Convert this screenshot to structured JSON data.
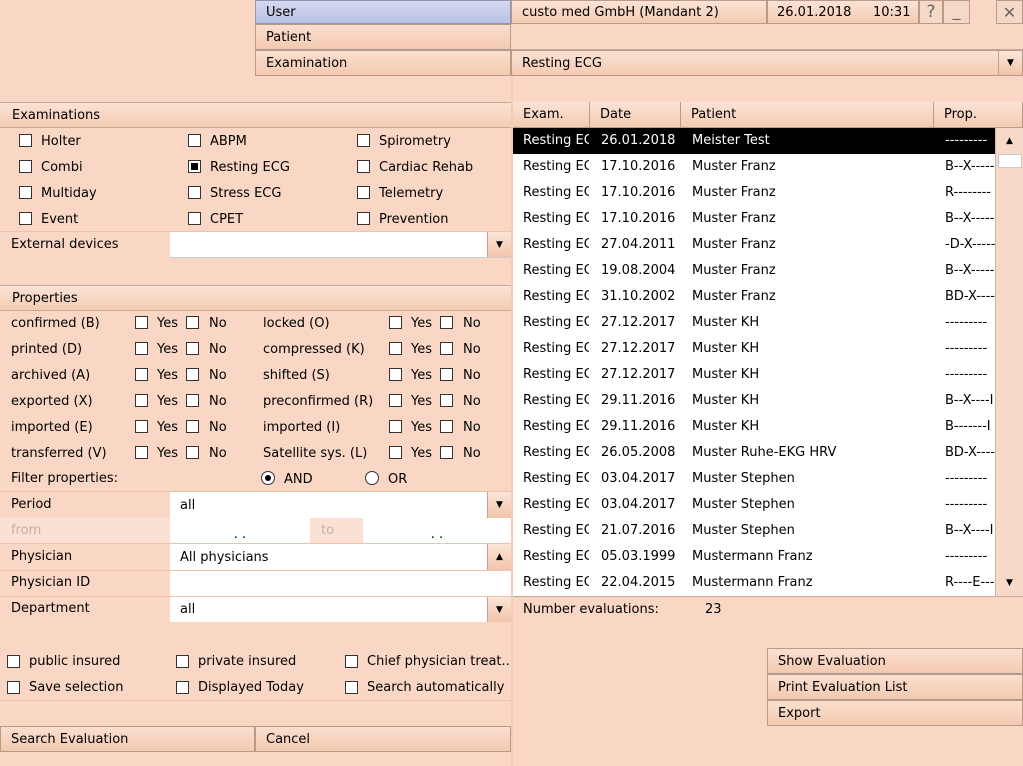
{
  "header": {
    "user_label": "User",
    "user_value": "custo med GmbH (Mandant 2)",
    "date": "26.01.2018",
    "time": "10:31",
    "help_glyph": "?",
    "minimize_glyph": "_",
    "close_glyph": "✕",
    "patient_label": "Patient",
    "patient_value": "",
    "examination_label": "Examination",
    "examination_value": "Resting ECG"
  },
  "examinations": {
    "title": "Examinations",
    "items": [
      {
        "label": "Holter",
        "checked": false
      },
      {
        "label": "ABPM",
        "checked": false
      },
      {
        "label": "Spirometry",
        "checked": false
      },
      {
        "label": "Combi",
        "checked": false
      },
      {
        "label": "Resting ECG",
        "checked": true
      },
      {
        "label": "Cardiac Rehab",
        "checked": false
      },
      {
        "label": "Multiday",
        "checked": false
      },
      {
        "label": "Stress ECG",
        "checked": false
      },
      {
        "label": "Telemetry",
        "checked": false
      },
      {
        "label": "Event",
        "checked": false
      },
      {
        "label": "CPET",
        "checked": false
      },
      {
        "label": "Prevention",
        "checked": false
      }
    ],
    "external_devices_label": "External devices",
    "external_devices_value": ""
  },
  "properties": {
    "title": "Properties",
    "yes": "Yes",
    "no": "No",
    "left": [
      "confirmed (B)",
      "printed (D)",
      "archived (A)",
      "exported (X)",
      "imported (E)",
      "transferred (V)"
    ],
    "right": [
      "locked (O)",
      "compressed (K)",
      "shifted (S)",
      "preconfirmed (R)",
      "imported (I)",
      "Satellite sys. (L)"
    ],
    "filter_label": "Filter properties:",
    "and_label": "AND",
    "or_label": "OR",
    "filter_selected": "AND"
  },
  "period": {
    "label": "Period",
    "value": "all",
    "from_label": "from",
    "to_label": "to",
    "from_value": ". .",
    "to_value": ". ."
  },
  "physician": {
    "label": "Physician",
    "value": "All physicians"
  },
  "physician_id": {
    "label": "Physician ID",
    "value": ""
  },
  "department": {
    "label": "Department",
    "value": "all"
  },
  "options": [
    {
      "label": "public insured",
      "checked": false
    },
    {
      "label": "private insured",
      "checked": false
    },
    {
      "label": "Chief physician treat...",
      "checked": false
    },
    {
      "label": "Save selection",
      "checked": false
    },
    {
      "label": "Displayed Today",
      "checked": false
    },
    {
      "label": "Search automatically",
      "checked": false
    }
  ],
  "buttons": {
    "search": "Search Evaluation",
    "cancel": "Cancel",
    "show": "Show Evaluation",
    "print": "Print Evaluation List",
    "export": "Export"
  },
  "table": {
    "columns": [
      "Exam.",
      "Date",
      "Patient",
      "Prop."
    ],
    "rows": [
      [
        "Resting ECG",
        "26.01.2018",
        "Meister Test",
        "---------"
      ],
      [
        "Resting ECG",
        "17.10.2016",
        "Muster Franz",
        "B--X-----"
      ],
      [
        "Resting ECG",
        "17.10.2016",
        "Muster Franz",
        "R--------"
      ],
      [
        "Resting ECG",
        "17.10.2016",
        "Muster Franz",
        "B--X-----"
      ],
      [
        "Resting ECG",
        "27.04.2011",
        "Muster Franz",
        "-D-X-----"
      ],
      [
        "Resting ECG",
        "19.08.2004",
        "Muster Franz",
        "B--X-----"
      ],
      [
        "Resting ECG",
        "31.10.2002",
        "Muster Franz",
        "BD-X-----"
      ],
      [
        "Resting ECG",
        "27.12.2017",
        "Muster KH",
        "---------"
      ],
      [
        "Resting ECG",
        "27.12.2017",
        "Muster KH",
        "---------"
      ],
      [
        "Resting ECG",
        "27.12.2017",
        "Muster KH",
        "---------"
      ],
      [
        "Resting ECG",
        "29.11.2016",
        "Muster KH",
        "B--X----I"
      ],
      [
        "Resting ECG",
        "29.11.2016",
        "Muster KH",
        "B-------I"
      ],
      [
        "Resting ECG",
        "26.05.2008",
        "Muster Ruhe-EKG HRV",
        "BD-X-----"
      ],
      [
        "Resting ECG",
        "03.04.2017",
        "Muster Stephen",
        "---------"
      ],
      [
        "Resting ECG",
        "03.04.2017",
        "Muster Stephen",
        "---------"
      ],
      [
        "Resting ECG",
        "21.07.2016",
        "Muster Stephen",
        "B--X----I"
      ],
      [
        "Resting ECG",
        "05.03.1999",
        "Mustermann Franz",
        "---------"
      ],
      [
        "Resting ECG",
        "22.04.2015",
        "Mustermann Franz",
        "R----E---"
      ]
    ],
    "selected_row": 0,
    "count_label": "Number evaluations:",
    "count_value": "23"
  },
  "icons": {
    "dropdown": "chevron-down-icon",
    "dropup": "chevron-up-icon",
    "scroll_up": "scroll-up-icon",
    "scroll_down": "scroll-down-icon"
  }
}
